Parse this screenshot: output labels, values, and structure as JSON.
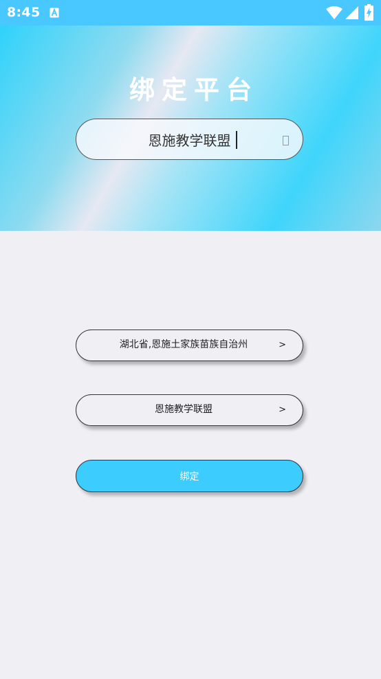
{
  "status_bar": {
    "time": "8:45",
    "icons": [
      "a-app-icon",
      "wifi-icon",
      "signal-icon",
      "battery-charging-icon"
    ]
  },
  "header": {
    "title": "绑定平台",
    "search_value": "恩施教学联盟"
  },
  "form": {
    "region_label": "湖北省,恩施土家族苗族自治州",
    "alliance_label": "恩施教学联盟",
    "arrow": ">",
    "bind_label": "绑定"
  },
  "colors": {
    "status_bar": "#49c7ff",
    "accent": "#3ccdfe",
    "page_background": "#f0eff4"
  }
}
